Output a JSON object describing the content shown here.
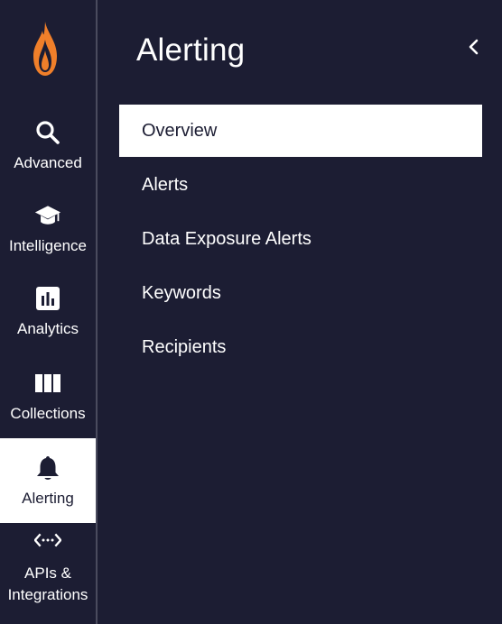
{
  "theme": {
    "background": "#1c1d33",
    "active_background": "#ffffff",
    "brand_flame": "#f07f2a"
  },
  "rail": {
    "logo": "flame-logo",
    "items": [
      {
        "label": "Advanced",
        "icon": "search-icon"
      },
      {
        "label": "Intelligence",
        "icon": "graduation-cap-icon"
      },
      {
        "label": "Analytics",
        "icon": "bar-chart-icon"
      },
      {
        "label": "Collections",
        "icon": "columns-icon"
      },
      {
        "label": "Alerting",
        "icon": "bell-icon",
        "active": true
      },
      {
        "label_line1": "APIs &",
        "label_line2": "Integrations",
        "icon": "code-arrows-icon"
      }
    ]
  },
  "panel": {
    "title": "Alerting",
    "collapse_icon": "chevron-left-icon",
    "menu": [
      {
        "label": "Overview",
        "active": true
      },
      {
        "label": "Alerts"
      },
      {
        "label": "Data Exposure Alerts"
      },
      {
        "label": "Keywords"
      },
      {
        "label": "Recipients"
      }
    ]
  }
}
